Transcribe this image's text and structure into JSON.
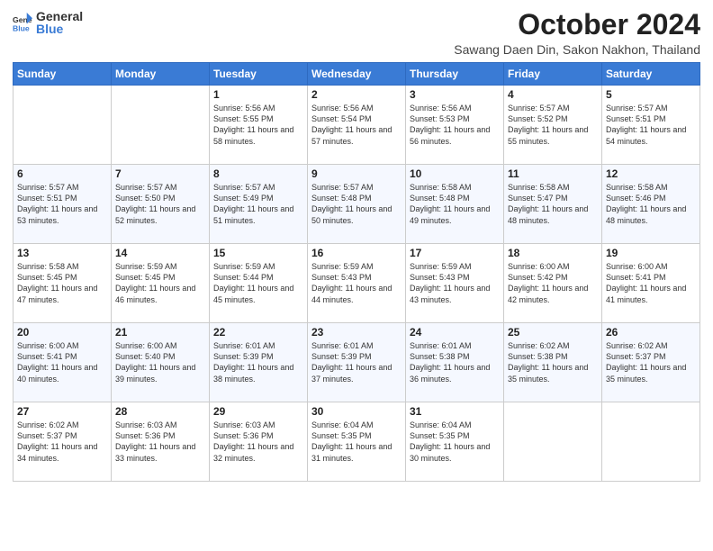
{
  "logo": {
    "general": "General",
    "blue": "Blue"
  },
  "header": {
    "title": "October 2024",
    "subtitle": "Sawang Daen Din, Sakon Nakhon, Thailand"
  },
  "weekdays": [
    "Sunday",
    "Monday",
    "Tuesday",
    "Wednesday",
    "Thursday",
    "Friday",
    "Saturday"
  ],
  "weeks": [
    [
      {
        "day": "",
        "sunrise": "",
        "sunset": "",
        "daylight": ""
      },
      {
        "day": "",
        "sunrise": "",
        "sunset": "",
        "daylight": ""
      },
      {
        "day": "1",
        "sunrise": "Sunrise: 5:56 AM",
        "sunset": "Sunset: 5:55 PM",
        "daylight": "Daylight: 11 hours and 58 minutes."
      },
      {
        "day": "2",
        "sunrise": "Sunrise: 5:56 AM",
        "sunset": "Sunset: 5:54 PM",
        "daylight": "Daylight: 11 hours and 57 minutes."
      },
      {
        "day": "3",
        "sunrise": "Sunrise: 5:56 AM",
        "sunset": "Sunset: 5:53 PM",
        "daylight": "Daylight: 11 hours and 56 minutes."
      },
      {
        "day": "4",
        "sunrise": "Sunrise: 5:57 AM",
        "sunset": "Sunset: 5:52 PM",
        "daylight": "Daylight: 11 hours and 55 minutes."
      },
      {
        "day": "5",
        "sunrise": "Sunrise: 5:57 AM",
        "sunset": "Sunset: 5:51 PM",
        "daylight": "Daylight: 11 hours and 54 minutes."
      }
    ],
    [
      {
        "day": "6",
        "sunrise": "Sunrise: 5:57 AM",
        "sunset": "Sunset: 5:51 PM",
        "daylight": "Daylight: 11 hours and 53 minutes."
      },
      {
        "day": "7",
        "sunrise": "Sunrise: 5:57 AM",
        "sunset": "Sunset: 5:50 PM",
        "daylight": "Daylight: 11 hours and 52 minutes."
      },
      {
        "day": "8",
        "sunrise": "Sunrise: 5:57 AM",
        "sunset": "Sunset: 5:49 PM",
        "daylight": "Daylight: 11 hours and 51 minutes."
      },
      {
        "day": "9",
        "sunrise": "Sunrise: 5:57 AM",
        "sunset": "Sunset: 5:48 PM",
        "daylight": "Daylight: 11 hours and 50 minutes."
      },
      {
        "day": "10",
        "sunrise": "Sunrise: 5:58 AM",
        "sunset": "Sunset: 5:48 PM",
        "daylight": "Daylight: 11 hours and 49 minutes."
      },
      {
        "day": "11",
        "sunrise": "Sunrise: 5:58 AM",
        "sunset": "Sunset: 5:47 PM",
        "daylight": "Daylight: 11 hours and 48 minutes."
      },
      {
        "day": "12",
        "sunrise": "Sunrise: 5:58 AM",
        "sunset": "Sunset: 5:46 PM",
        "daylight": "Daylight: 11 hours and 48 minutes."
      }
    ],
    [
      {
        "day": "13",
        "sunrise": "Sunrise: 5:58 AM",
        "sunset": "Sunset: 5:45 PM",
        "daylight": "Daylight: 11 hours and 47 minutes."
      },
      {
        "day": "14",
        "sunrise": "Sunrise: 5:59 AM",
        "sunset": "Sunset: 5:45 PM",
        "daylight": "Daylight: 11 hours and 46 minutes."
      },
      {
        "day": "15",
        "sunrise": "Sunrise: 5:59 AM",
        "sunset": "Sunset: 5:44 PM",
        "daylight": "Daylight: 11 hours and 45 minutes."
      },
      {
        "day": "16",
        "sunrise": "Sunrise: 5:59 AM",
        "sunset": "Sunset: 5:43 PM",
        "daylight": "Daylight: 11 hours and 44 minutes."
      },
      {
        "day": "17",
        "sunrise": "Sunrise: 5:59 AM",
        "sunset": "Sunset: 5:43 PM",
        "daylight": "Daylight: 11 hours and 43 minutes."
      },
      {
        "day": "18",
        "sunrise": "Sunrise: 6:00 AM",
        "sunset": "Sunset: 5:42 PM",
        "daylight": "Daylight: 11 hours and 42 minutes."
      },
      {
        "day": "19",
        "sunrise": "Sunrise: 6:00 AM",
        "sunset": "Sunset: 5:41 PM",
        "daylight": "Daylight: 11 hours and 41 minutes."
      }
    ],
    [
      {
        "day": "20",
        "sunrise": "Sunrise: 6:00 AM",
        "sunset": "Sunset: 5:41 PM",
        "daylight": "Daylight: 11 hours and 40 minutes."
      },
      {
        "day": "21",
        "sunrise": "Sunrise: 6:00 AM",
        "sunset": "Sunset: 5:40 PM",
        "daylight": "Daylight: 11 hours and 39 minutes."
      },
      {
        "day": "22",
        "sunrise": "Sunrise: 6:01 AM",
        "sunset": "Sunset: 5:39 PM",
        "daylight": "Daylight: 11 hours and 38 minutes."
      },
      {
        "day": "23",
        "sunrise": "Sunrise: 6:01 AM",
        "sunset": "Sunset: 5:39 PM",
        "daylight": "Daylight: 11 hours and 37 minutes."
      },
      {
        "day": "24",
        "sunrise": "Sunrise: 6:01 AM",
        "sunset": "Sunset: 5:38 PM",
        "daylight": "Daylight: 11 hours and 36 minutes."
      },
      {
        "day": "25",
        "sunrise": "Sunrise: 6:02 AM",
        "sunset": "Sunset: 5:38 PM",
        "daylight": "Daylight: 11 hours and 35 minutes."
      },
      {
        "day": "26",
        "sunrise": "Sunrise: 6:02 AM",
        "sunset": "Sunset: 5:37 PM",
        "daylight": "Daylight: 11 hours and 35 minutes."
      }
    ],
    [
      {
        "day": "27",
        "sunrise": "Sunrise: 6:02 AM",
        "sunset": "Sunset: 5:37 PM",
        "daylight": "Daylight: 11 hours and 34 minutes."
      },
      {
        "day": "28",
        "sunrise": "Sunrise: 6:03 AM",
        "sunset": "Sunset: 5:36 PM",
        "daylight": "Daylight: 11 hours and 33 minutes."
      },
      {
        "day": "29",
        "sunrise": "Sunrise: 6:03 AM",
        "sunset": "Sunset: 5:36 PM",
        "daylight": "Daylight: 11 hours and 32 minutes."
      },
      {
        "day": "30",
        "sunrise": "Sunrise: 6:04 AM",
        "sunset": "Sunset: 5:35 PM",
        "daylight": "Daylight: 11 hours and 31 minutes."
      },
      {
        "day": "31",
        "sunrise": "Sunrise: 6:04 AM",
        "sunset": "Sunset: 5:35 PM",
        "daylight": "Daylight: 11 hours and 30 minutes."
      },
      {
        "day": "",
        "sunrise": "",
        "sunset": "",
        "daylight": ""
      },
      {
        "day": "",
        "sunrise": "",
        "sunset": "",
        "daylight": ""
      }
    ]
  ]
}
